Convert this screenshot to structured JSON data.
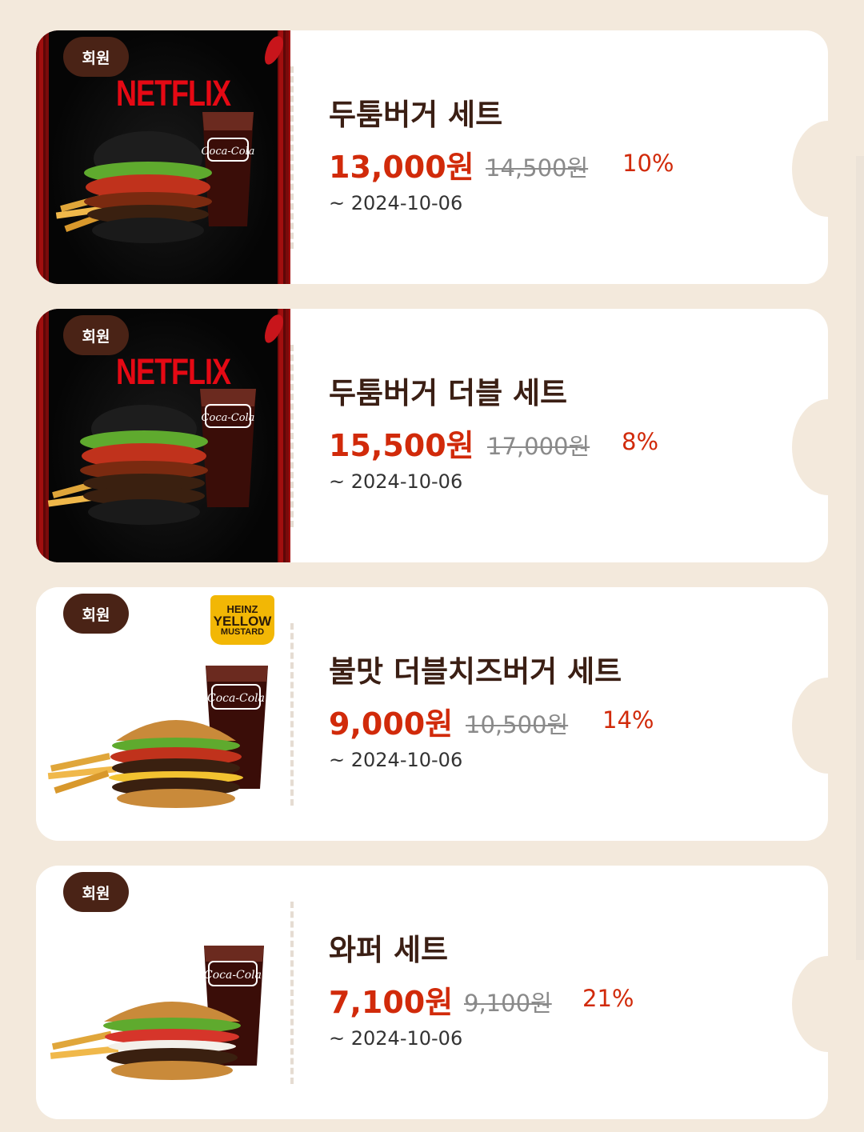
{
  "coupons": [
    {
      "badge": "회원",
      "brand_text": "NETFLIX",
      "theme": "netflix",
      "title": "두툼버거 세트",
      "price": "13,000원",
      "original_price": "14,500원",
      "discount": "10%",
      "expiry": "~ 2024-10-06"
    },
    {
      "badge": "회원",
      "brand_text": "NETFLIX",
      "theme": "netflix",
      "title": "두툼버거 더블 세트",
      "price": "15,500원",
      "original_price": "17,000원",
      "discount": "8%",
      "expiry": "~ 2024-10-06"
    },
    {
      "badge": "회원",
      "brand_text": "HEINZ YELLOW MUSTARD",
      "theme": "heinz",
      "title": "불맛 더블치즈버거 세트",
      "price": "9,000원",
      "original_price": "10,500원",
      "discount": "14%",
      "expiry": "~ 2024-10-06"
    },
    {
      "badge": "회원",
      "theme": "plain",
      "title": "와퍼 세트",
      "price": "7,100원",
      "original_price": "9,100원",
      "discount": "21%",
      "expiry": "~ 2024-10-06"
    }
  ],
  "heinz_lines": [
    "HEINZ",
    "YELLOW",
    "MUSTARD"
  ],
  "cup_text": "Coca-Cola",
  "colors": {
    "background": "#f3e9dc",
    "badge": "#4a2316",
    "price": "#d12a0a",
    "title": "#3b1f14"
  }
}
